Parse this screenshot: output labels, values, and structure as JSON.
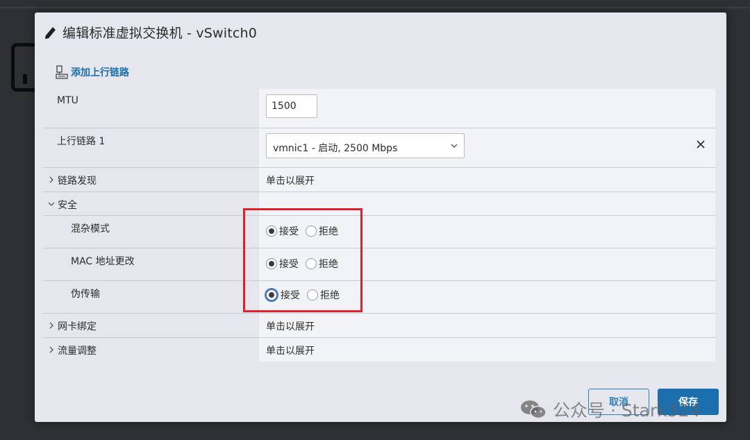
{
  "dialog": {
    "title": "编辑标准虚拟交换机 - vSwitch0",
    "add_uplink": "添加上行链路"
  },
  "rows": {
    "mtu": {
      "label": "MTU",
      "value": "1500"
    },
    "uplink1": {
      "label": "上行链路 1",
      "value": "vmnic1 - 启动, 2500 Mbps"
    },
    "link_discovery": {
      "label": "链路发现",
      "value": "单击以展开"
    },
    "security": {
      "label": "安全",
      "promiscuous": {
        "label": "混杂模式",
        "accept": "接受",
        "reject": "拒绝",
        "selected": "accept"
      },
      "mac_change": {
        "label": "MAC 地址更改",
        "accept": "接受",
        "reject": "拒绝",
        "selected": "accept"
      },
      "forged_transmits": {
        "label": "伪传输",
        "accept": "接受",
        "reject": "拒绝",
        "selected": "accept"
      }
    },
    "teaming": {
      "label": "网卡绑定",
      "value": "单击以展开"
    },
    "traffic_shaping": {
      "label": "流量调整",
      "value": "单击以展开"
    }
  },
  "buttons": {
    "cancel": "取消",
    "save": "保存"
  },
  "watermark": "公众号 · Stark324",
  "colors": {
    "accent": "#1b6fae",
    "link": "#1a6fa8",
    "highlight": "#e0202a",
    "dialog_bg": "#e6e7ee",
    "backdrop": "#2f3033"
  },
  "icons": {
    "title": "pencil-icon",
    "add_uplink": "network-adapter-icon",
    "remove_uplink": "close-icon",
    "collapsed": "chevron-right-icon",
    "expanded": "chevron-down-icon"
  }
}
